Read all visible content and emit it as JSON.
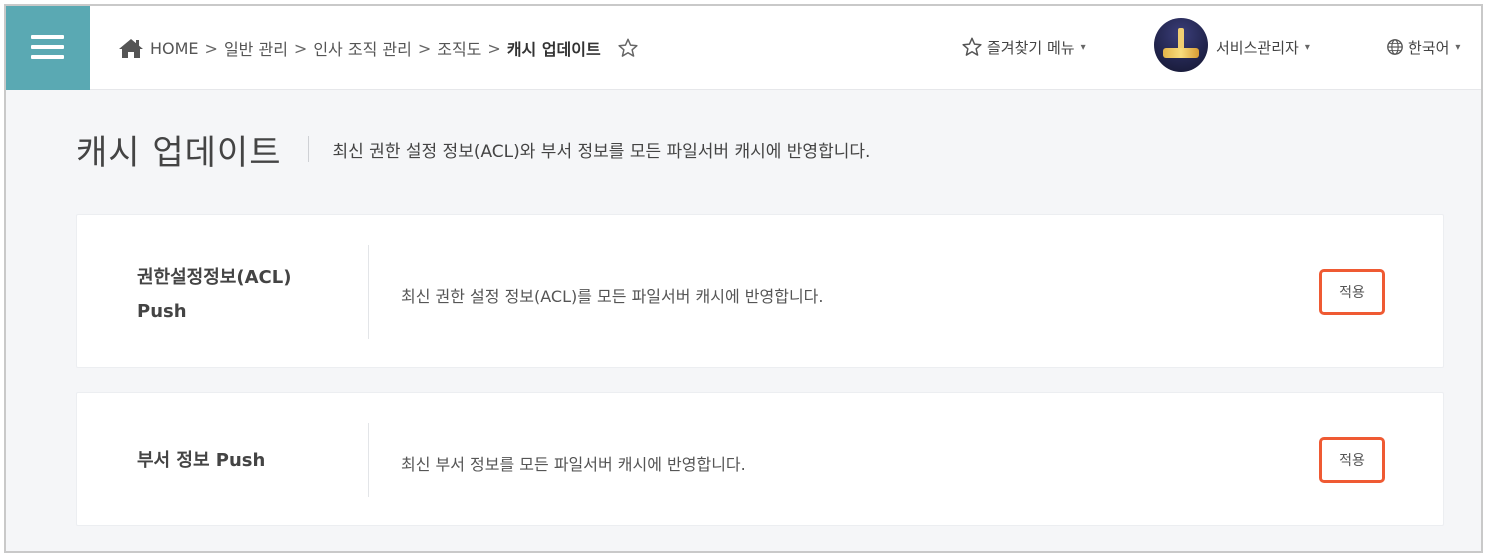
{
  "breadcrumb": {
    "home": "HOME",
    "separator": ">",
    "items": [
      "일반 관리",
      "인사 조직 관리",
      "조직도"
    ],
    "current": "캐시 업데이트"
  },
  "header": {
    "favorites_label": "즐겨찾기 메뉴",
    "user_label": "서비스관리자",
    "language_label": "한국어",
    "caret": "▾"
  },
  "page": {
    "title": "캐시 업데이트",
    "description": "최신 권한 설정 정보(ACL)와 부서 정보를 모든 파일서버 캐시에 반영합니다."
  },
  "cards": [
    {
      "label_line1": "권한설정정보(ACL)",
      "label_line2": "Push",
      "description": "최신 권한 설정 정보(ACL)를 모든 파일서버 캐시에 반영합니다.",
      "button": "적용"
    },
    {
      "label_line1": "부서 정보 Push",
      "description": "최신 부서 정보를 모든 파일서버 캐시에 반영합니다.",
      "button": "적용"
    }
  ],
  "colors": {
    "menu_accent": "#5aa9b3",
    "highlight": "#ef5a33",
    "background": "#f5f6f8"
  },
  "icons": [
    "menu-icon",
    "home-icon",
    "star-outline-icon",
    "caret-down-icon",
    "globe-icon"
  ]
}
